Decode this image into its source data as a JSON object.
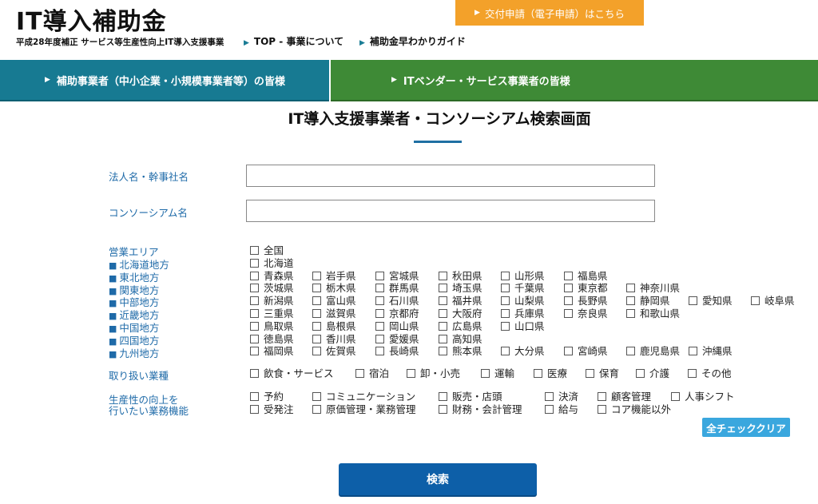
{
  "header": {
    "logo": "IT導入補助金",
    "subtitle": "平成28年度補正 サービス等生産性向上IT導入支援事業",
    "links": [
      "TOP - 事業について",
      "補助金早わかりガイド"
    ],
    "apply_button": "交付申請（電子申請）はこちら"
  },
  "nav": {
    "tab1": "補助事業者（中小企業・小規模事業者等）の皆様",
    "tab2": "ITベンダー・サービス事業者の皆様"
  },
  "page_title": "IT導入支援事業者・コンソーシアム検索画面",
  "form": {
    "company_label": "法人名・幹事社名",
    "company_value": "",
    "consortium_label": "コンソーシアム名",
    "consortium_value": "",
    "area_label": "営業エリア",
    "regions": [
      "北海道地方",
      "東北地方",
      "関東地方",
      "中部地方",
      "近畿地方",
      "中国地方",
      "四国地方",
      "九州地方"
    ],
    "area_rows": [
      [
        "全国"
      ],
      [
        "北海道"
      ],
      [
        "青森県",
        "岩手県",
        "宮城県",
        "秋田県",
        "山形県",
        "福島県"
      ],
      [
        "茨城県",
        "栃木県",
        "群馬県",
        "埼玉県",
        "千葉県",
        "東京都",
        "神奈川県"
      ],
      [
        "新潟県",
        "富山県",
        "石川県",
        "福井県",
        "山梨県",
        "長野県",
        "静岡県",
        "愛知県",
        "岐阜県"
      ],
      [
        "三重県",
        "滋賀県",
        "京都府",
        "大阪府",
        "兵庫県",
        "奈良県",
        "和歌山県"
      ],
      [
        "鳥取県",
        "島根県",
        "岡山県",
        "広島県",
        "山口県"
      ],
      [
        "徳島県",
        "香川県",
        "愛媛県",
        "高知県"
      ],
      [
        "福岡県",
        "佐賀県",
        "長崎県",
        "熊本県",
        "大分県",
        "宮崎県",
        "鹿児島県",
        "沖縄県"
      ]
    ],
    "industry_label": "取り扱い業種",
    "industries": [
      "飲食・サービス",
      "宿泊",
      "卸・小売",
      "運輸",
      "医療",
      "保育",
      "介護",
      "その他"
    ],
    "function_label_line1": "生産性の向上を",
    "function_label_line2": "行いたい業務機能",
    "function_rows": [
      [
        "予約",
        "コミュニケーション",
        "販売・店頭",
        "決済",
        "顧客管理",
        "人事シフト"
      ],
      [
        "受発注",
        "原価管理・業務管理",
        "財務・会計管理",
        "給与",
        "コア機能以外"
      ]
    ],
    "clear_button": "全チェッククリア",
    "search_button": "検索"
  }
}
